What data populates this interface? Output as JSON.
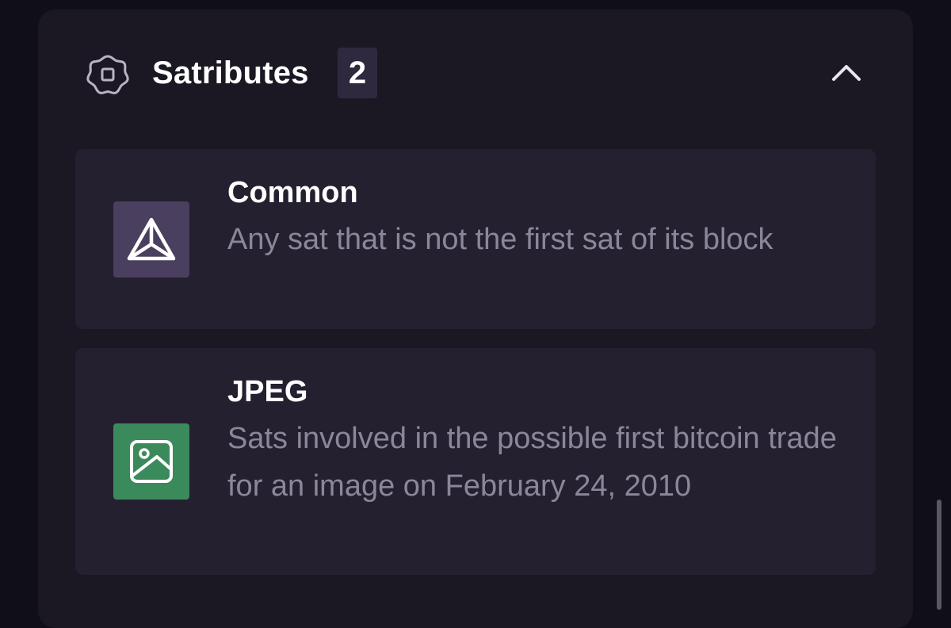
{
  "section": {
    "title": "Satributes",
    "count": "2",
    "icon": "satribute-flower-icon",
    "toggle_icon": "chevron-up-icon"
  },
  "satributes": [
    {
      "title": "Common",
      "description": "Any sat that is not the first sat of its block",
      "icon": "pyramid-icon",
      "icon_bg": "#4a3f5e"
    },
    {
      "title": "JPEG",
      "description": "Sats involved in the possible first bitcoin trade for an image on February 24, 2010",
      "icon": "image-icon",
      "icon_bg": "#3b8a5b"
    }
  ],
  "colors": {
    "page_bg": "#100e17",
    "panel_bg": "#1b1824",
    "card_bg": "#242030",
    "badge_bg": "#2f2940",
    "desc_text": "#8b8699"
  }
}
